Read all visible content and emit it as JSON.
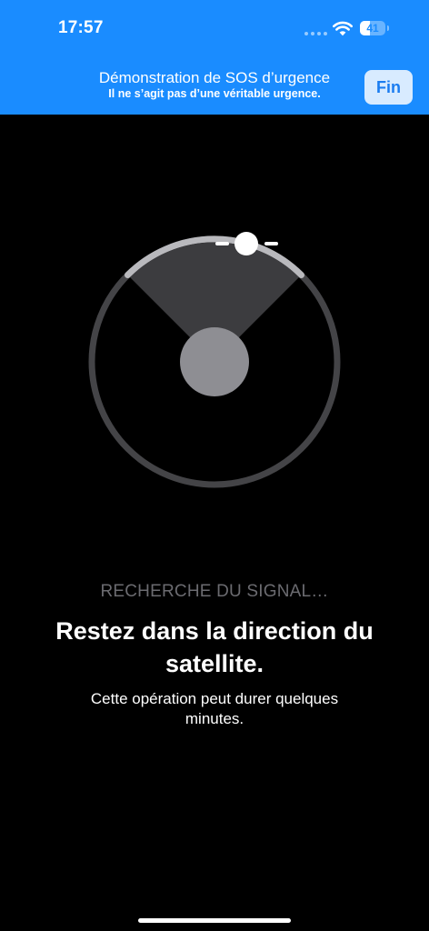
{
  "status_bar": {
    "time": "17:57",
    "battery_level": "41",
    "battery_fraction": 0.41
  },
  "banner": {
    "title": "Démonstration de SOS d’urgence",
    "subtitle": "Il ne s’agit pas d’une véritable urgence.",
    "done_label": "Fin",
    "background_color": "#1a8cff"
  },
  "main": {
    "status_label": "RECHERCHE DU SIGNAL…",
    "headline": "Restez dans la direction du satellite.",
    "description": "Cette opération peut durer quelques minutes."
  },
  "icons": [
    "wifi-icon",
    "battery-icon",
    "satellite-icon"
  ]
}
